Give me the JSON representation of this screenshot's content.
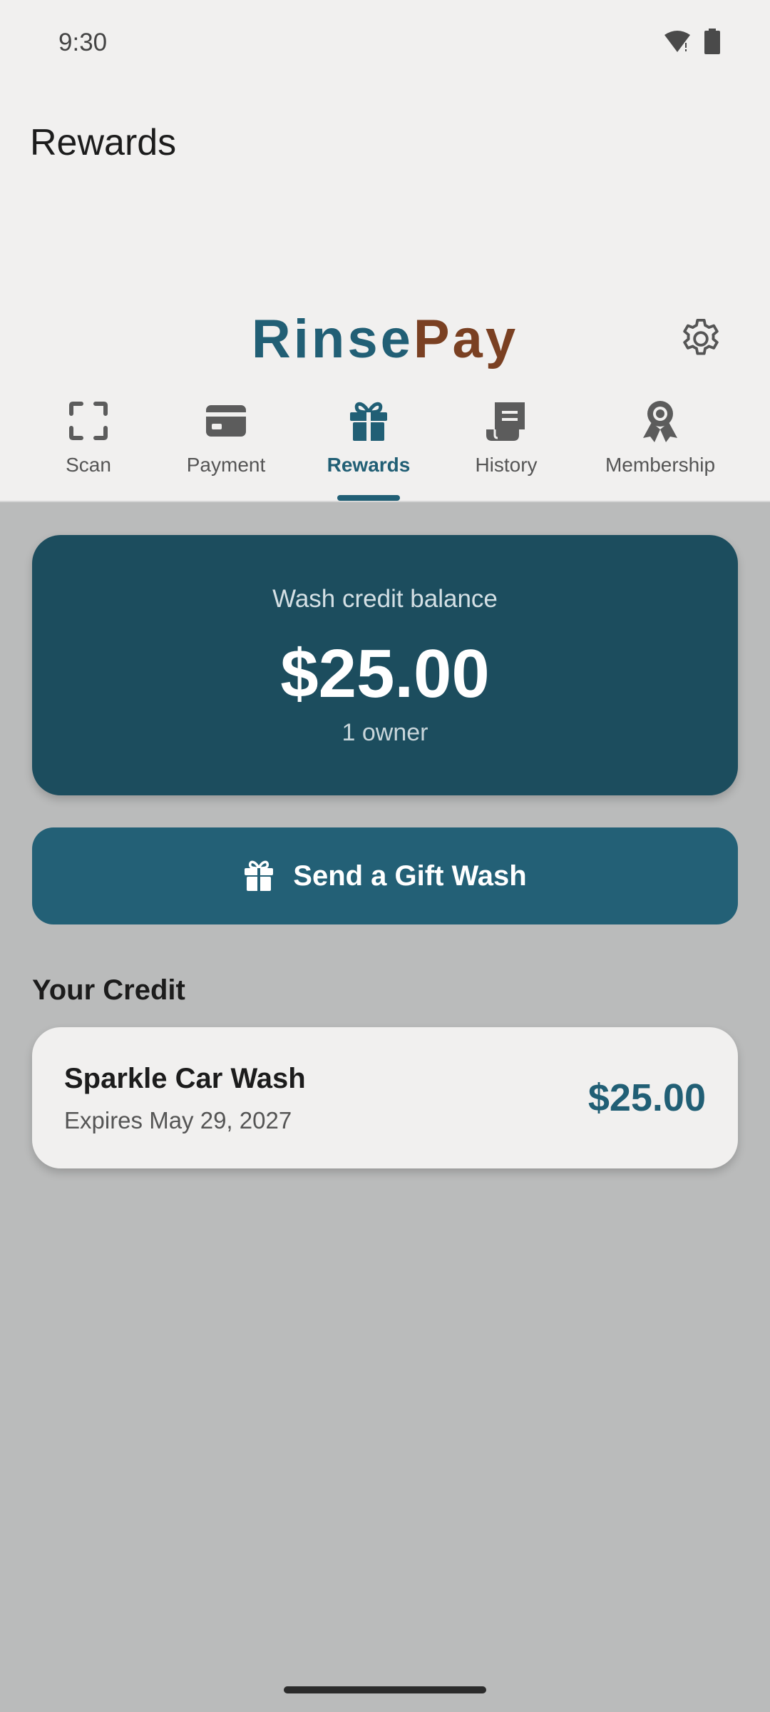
{
  "status_bar": {
    "time": "9:30",
    "icons": [
      "wifi-alert-icon",
      "battery-icon"
    ]
  },
  "page_title": "Rewards",
  "brand": {
    "part1": "Rinse",
    "part2": "Pay",
    "color1": "#215F75",
    "color2": "#7A4022"
  },
  "tabs": [
    {
      "label": "Scan",
      "icon": "scan-icon",
      "active": false
    },
    {
      "label": "Payment",
      "icon": "credit-card-icon",
      "active": false
    },
    {
      "label": "Rewards",
      "icon": "gift-icon",
      "active": true
    },
    {
      "label": "History",
      "icon": "receipt-icon",
      "active": false
    },
    {
      "label": "Membership",
      "icon": "award-icon",
      "active": false
    }
  ],
  "balance": {
    "label": "Wash credit balance",
    "amount": "$25.00",
    "owners": "1 owner"
  },
  "gift_button": {
    "label": "Send a Gift Wash",
    "icon": "gift-icon"
  },
  "credits_section": {
    "title": "Your Credit",
    "items": [
      {
        "name": "Sparkle Car Wash",
        "expires": "Expires May 29, 2027",
        "amount": "$25.00"
      }
    ]
  },
  "colors": {
    "accent": "#215F75",
    "card_dark": "#1C4D5E",
    "button": "#236076",
    "background": "#BABBBB"
  }
}
